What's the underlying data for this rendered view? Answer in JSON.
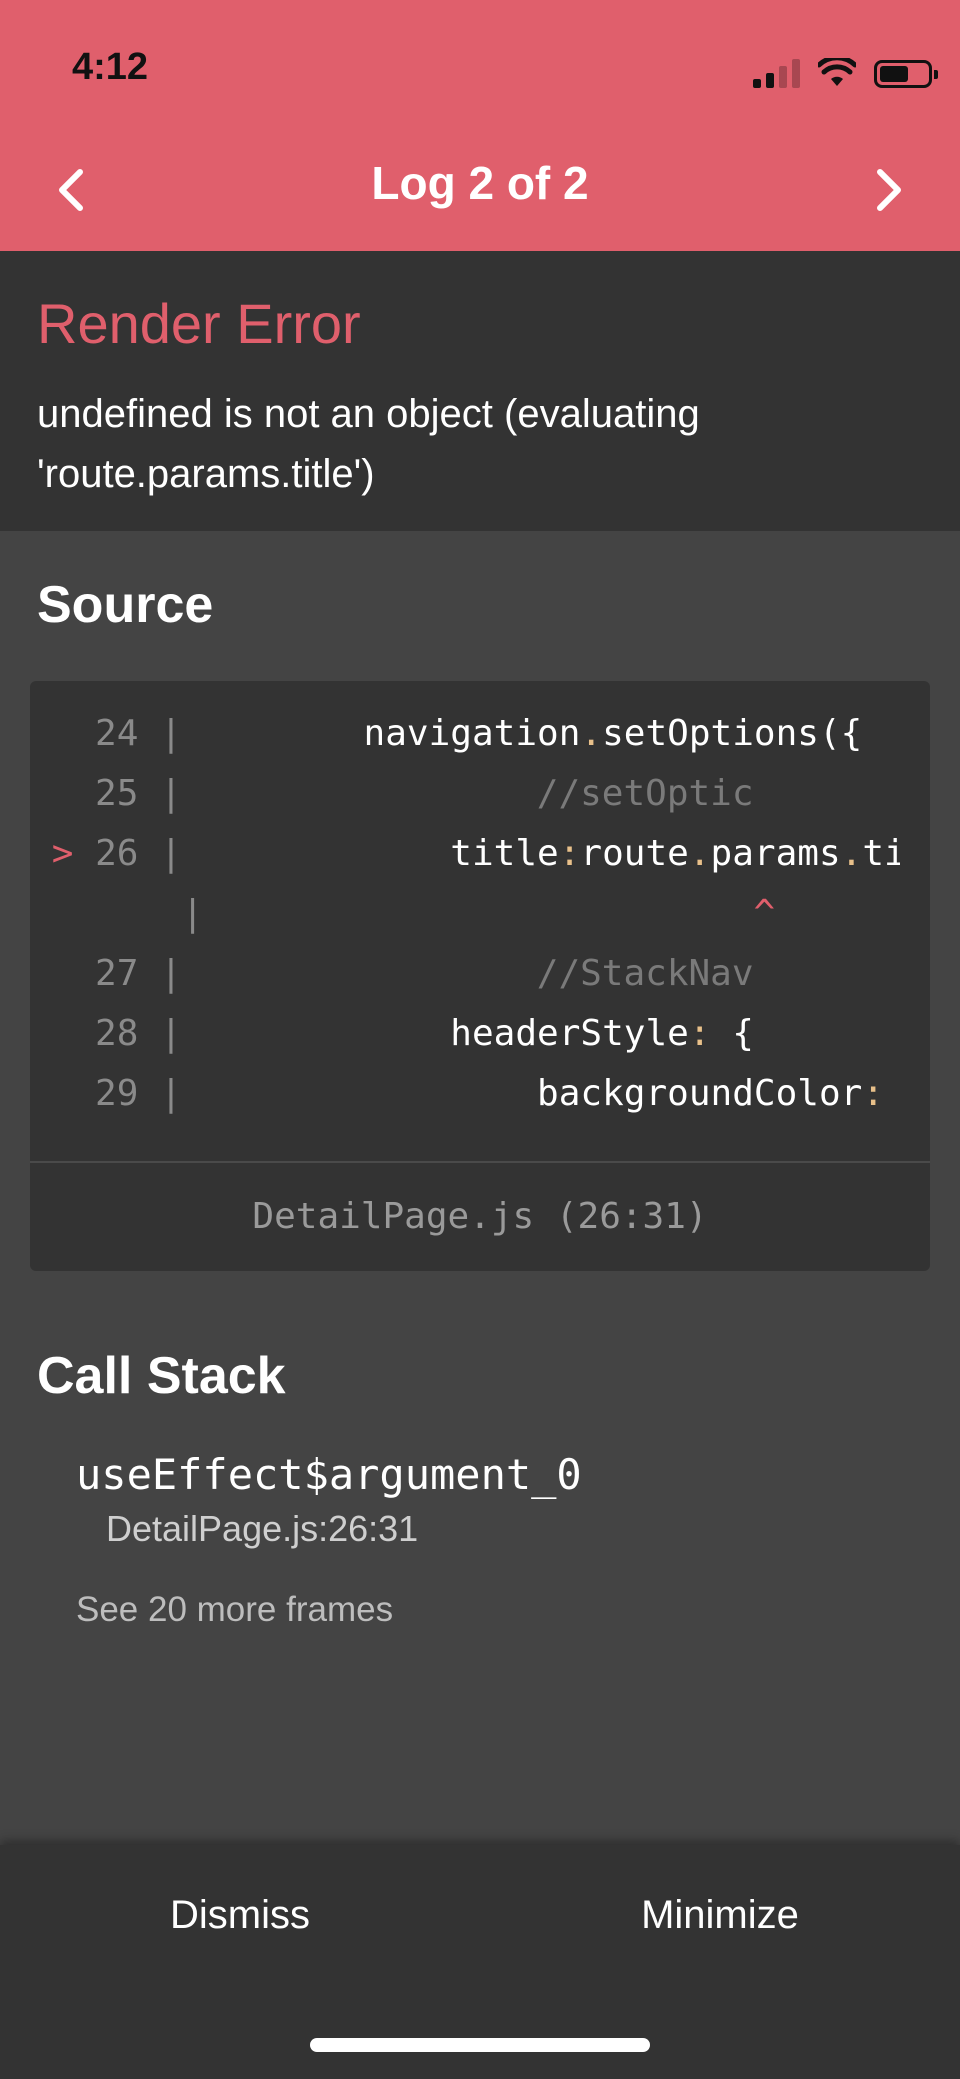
{
  "status_bar": {
    "time": "4:12"
  },
  "header": {
    "title": "Log 2 of 2",
    "accent_color": "#e05f6c"
  },
  "error": {
    "title": "Render Error",
    "message": "undefined is not an object (evaluating 'route.params.title')"
  },
  "source": {
    "heading": "Source",
    "lines": [
      {
        "number": "24",
        "marker": "",
        "code": "        navigation.setOptions({"
      },
      {
        "number": "25",
        "marker": "",
        "code": "                //setOptic"
      },
      {
        "number": "26",
        "marker": ">",
        "code": "            title:route.params.ti"
      },
      {
        "number": "",
        "marker": "",
        "code": "                          ^"
      },
      {
        "number": "27",
        "marker": "",
        "code": "                //StackNav"
      },
      {
        "number": "28",
        "marker": "",
        "code": "            headerStyle: {"
      },
      {
        "number": "29",
        "marker": "",
        "code": "                backgroundColor:"
      }
    ],
    "file_location": "DetailPage.js (26:31)"
  },
  "call_stack": {
    "heading": "Call Stack",
    "frames": [
      {
        "name": "useEffect$argument_0",
        "location": "DetailPage.js:26:31"
      }
    ],
    "more_frames": "See 20 more frames"
  },
  "footer": {
    "dismiss_label": "Dismiss",
    "minimize_label": "Minimize"
  }
}
